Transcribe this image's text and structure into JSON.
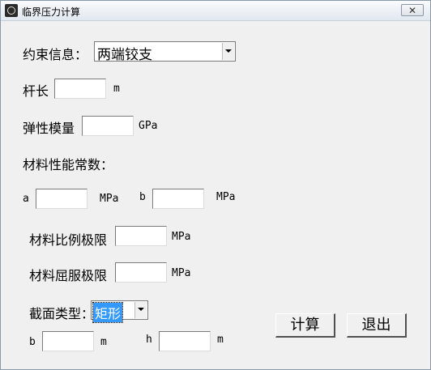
{
  "window": {
    "title": "临界压力计算",
    "close_label": "✕"
  },
  "constraint": {
    "label": "约束信息：",
    "value": "两端铰支"
  },
  "length": {
    "label": "杆长",
    "unit": "m",
    "value": ""
  },
  "modulus": {
    "label": "弹性模量",
    "unit": "GPa",
    "value": ""
  },
  "material_constants": {
    "label": "材料性能常数："
  },
  "a": {
    "label": "a",
    "unit": "MPa",
    "value": ""
  },
  "b": {
    "label": "b",
    "unit": "MPa",
    "value": ""
  },
  "proportional_limit": {
    "label": "材料比例极限",
    "unit": "MPa",
    "value": ""
  },
  "yield_limit": {
    "label": "材料屈服极限",
    "unit": "MPa",
    "value": ""
  },
  "section": {
    "label": "截面类型：",
    "value": "矩形"
  },
  "section_b": {
    "label": "b",
    "unit": "m",
    "value": ""
  },
  "section_h": {
    "label": "h",
    "unit": "m",
    "value": ""
  },
  "buttons": {
    "calculate": "计算",
    "exit": "退出"
  }
}
